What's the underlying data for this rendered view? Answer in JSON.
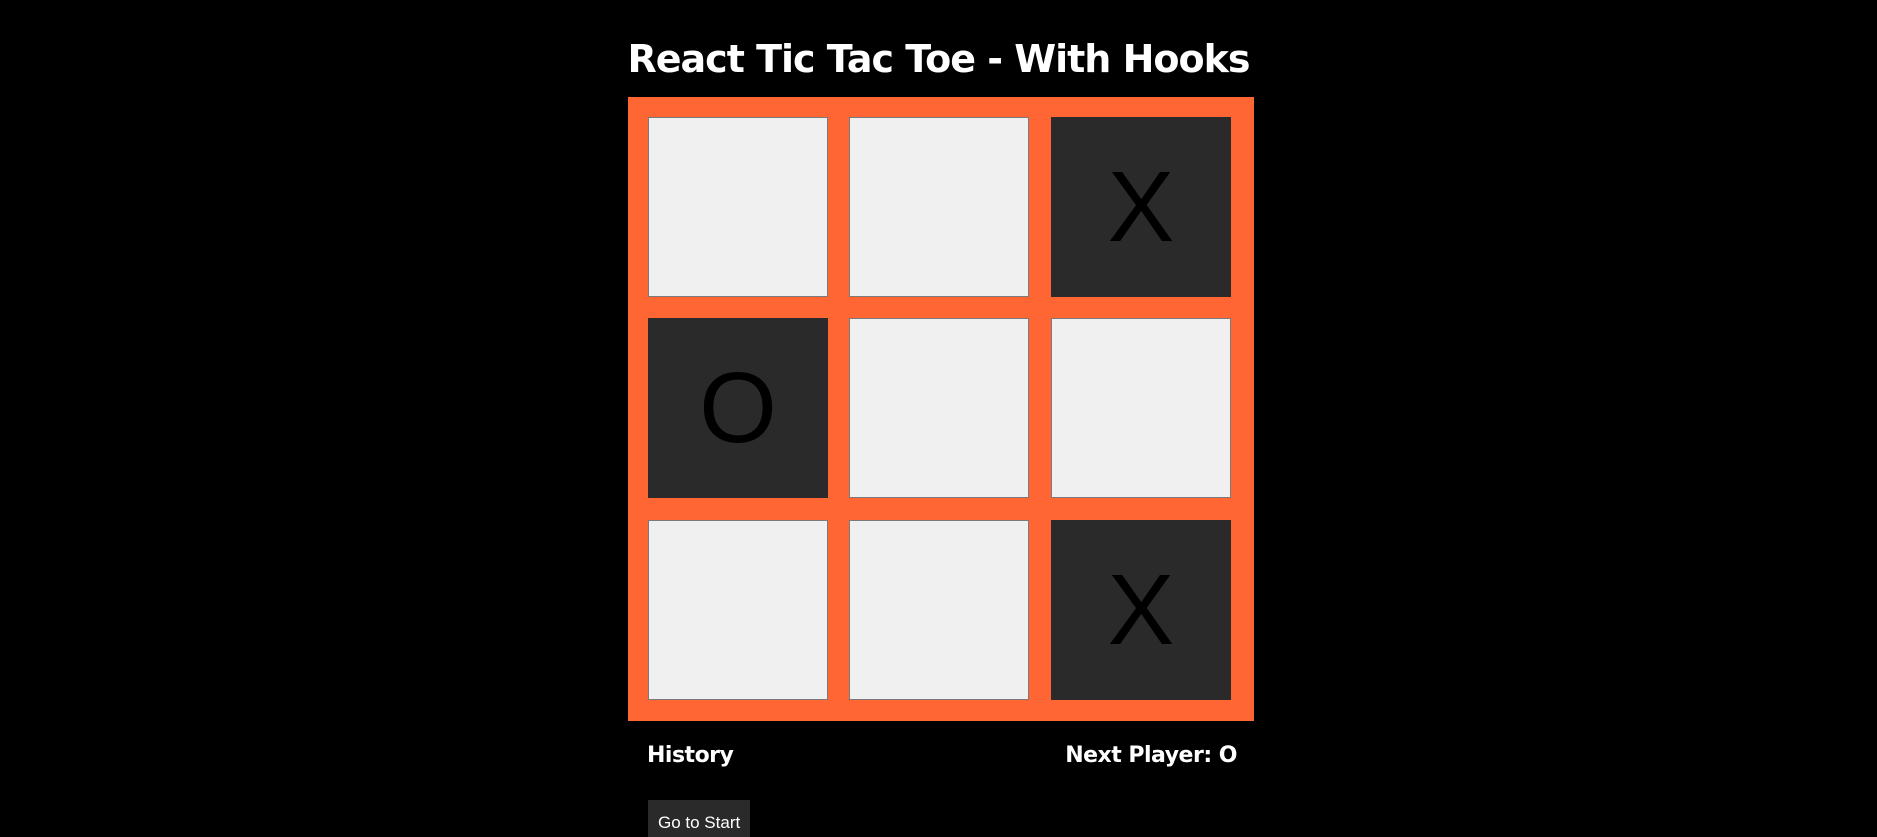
{
  "header": {
    "title": "React Tic Tac Toe - With Hooks"
  },
  "board": {
    "cells": [
      "",
      "",
      "X",
      "O",
      "",
      "",
      "",
      "",
      "X"
    ],
    "colors": {
      "board_background": "#ff6633",
      "empty_cell": "#f0f0f0",
      "filled_cell": "#2a2a2a",
      "mark": "#000000"
    }
  },
  "footer": {
    "history_label": "History",
    "next_player_label": "Next Player: O",
    "moves": [
      {
        "label": "Go to Start"
      }
    ]
  }
}
